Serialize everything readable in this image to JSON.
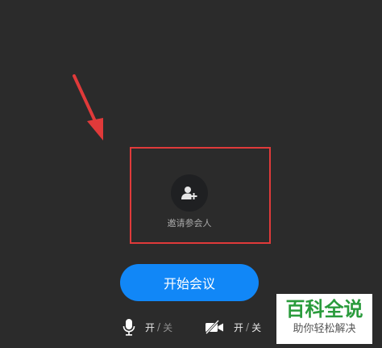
{
  "invite": {
    "label": "邀请参会人",
    "icon": "add-user-icon"
  },
  "start_button": {
    "label": "开始会议",
    "color": "#1187f7"
  },
  "mic_toggle": {
    "icon": "microphone-icon",
    "on_label": "开",
    "separator": "/",
    "off_label": "关"
  },
  "camera_toggle": {
    "icon": "camera-off-icon",
    "on_label": "开",
    "separator": "/",
    "off_label": "关"
  },
  "annotation": {
    "color": "#e03a3a"
  },
  "watermark": {
    "title": "百科全说",
    "subtitle": "助你轻松解决"
  }
}
